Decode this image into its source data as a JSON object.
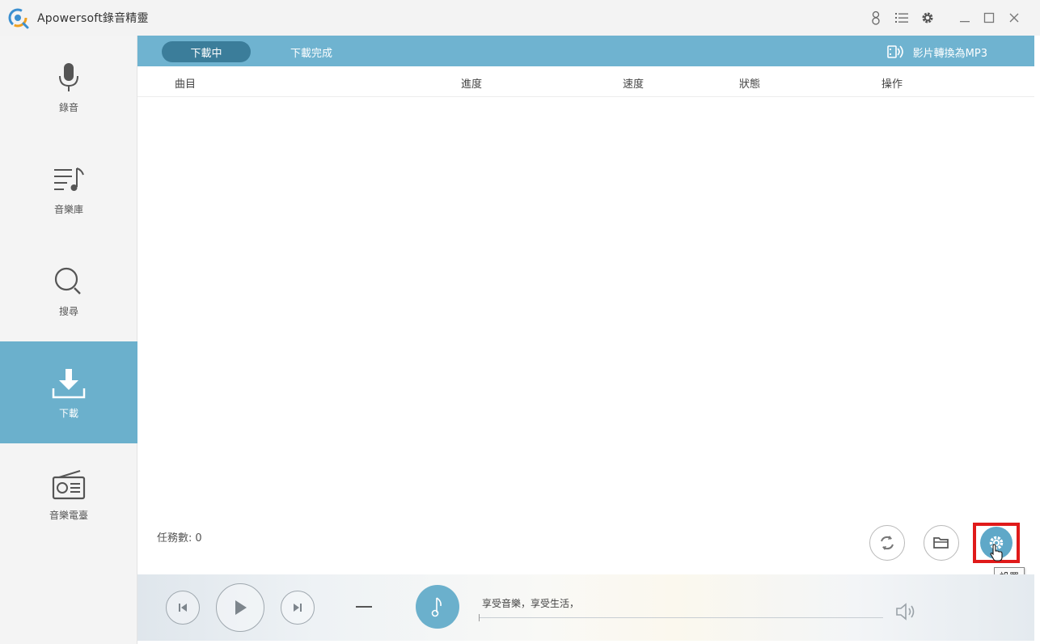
{
  "app": {
    "title": "Apowersoft錄音精靈"
  },
  "titlebar": {
    "icons": [
      "user-icon",
      "list-menu-icon",
      "gear-icon",
      "minimize-icon",
      "maximize-icon",
      "close-icon"
    ]
  },
  "sidebar": {
    "items": [
      {
        "label": "錄音",
        "icon": "microphone-icon"
      },
      {
        "label": "音樂庫",
        "icon": "music-list-icon"
      },
      {
        "label": "搜尋",
        "icon": "search-icon"
      },
      {
        "label": "下載",
        "icon": "download-icon",
        "active": true
      },
      {
        "label": "音樂電臺",
        "icon": "radio-icon"
      }
    ]
  },
  "tabs": {
    "downloading": "下載中",
    "completed": "下載完成"
  },
  "convert": {
    "label": "影片轉換為MP3"
  },
  "table": {
    "columns": [
      "曲目",
      "進度",
      "速度",
      "狀態",
      "操作"
    ]
  },
  "tasks": {
    "label": "任務數:",
    "count": "0"
  },
  "actions": {
    "settings_tooltip": "設置"
  },
  "player": {
    "now_playing": "享受音樂，享受生活，"
  },
  "colors": {
    "accent": "#6fb3d0",
    "active_tab": "#3b7d9a",
    "highlight": "#e01a1a"
  }
}
